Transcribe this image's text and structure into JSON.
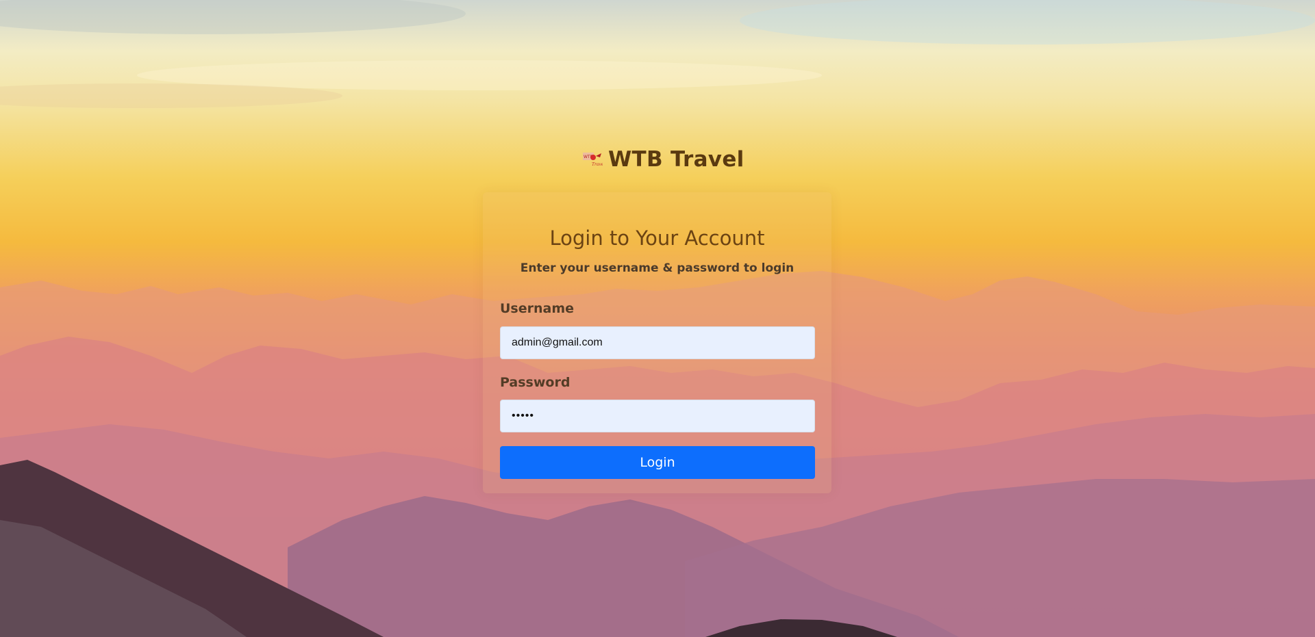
{
  "brand": {
    "logo_icon": "wtb-travel-logo-icon",
    "name": "WTB Travel",
    "name_color": "#5a3a10"
  },
  "login_card": {
    "title": "Login to Your Account",
    "subtitle": "Enter your username & password to login",
    "username": {
      "label": "Username",
      "value": "admin@gmail.com"
    },
    "password": {
      "label": "Password",
      "value": "•••••"
    },
    "submit_label": "Login",
    "submit_color": "#0d6efd"
  },
  "background": {
    "description_icon": "mountain-sunset-background"
  }
}
